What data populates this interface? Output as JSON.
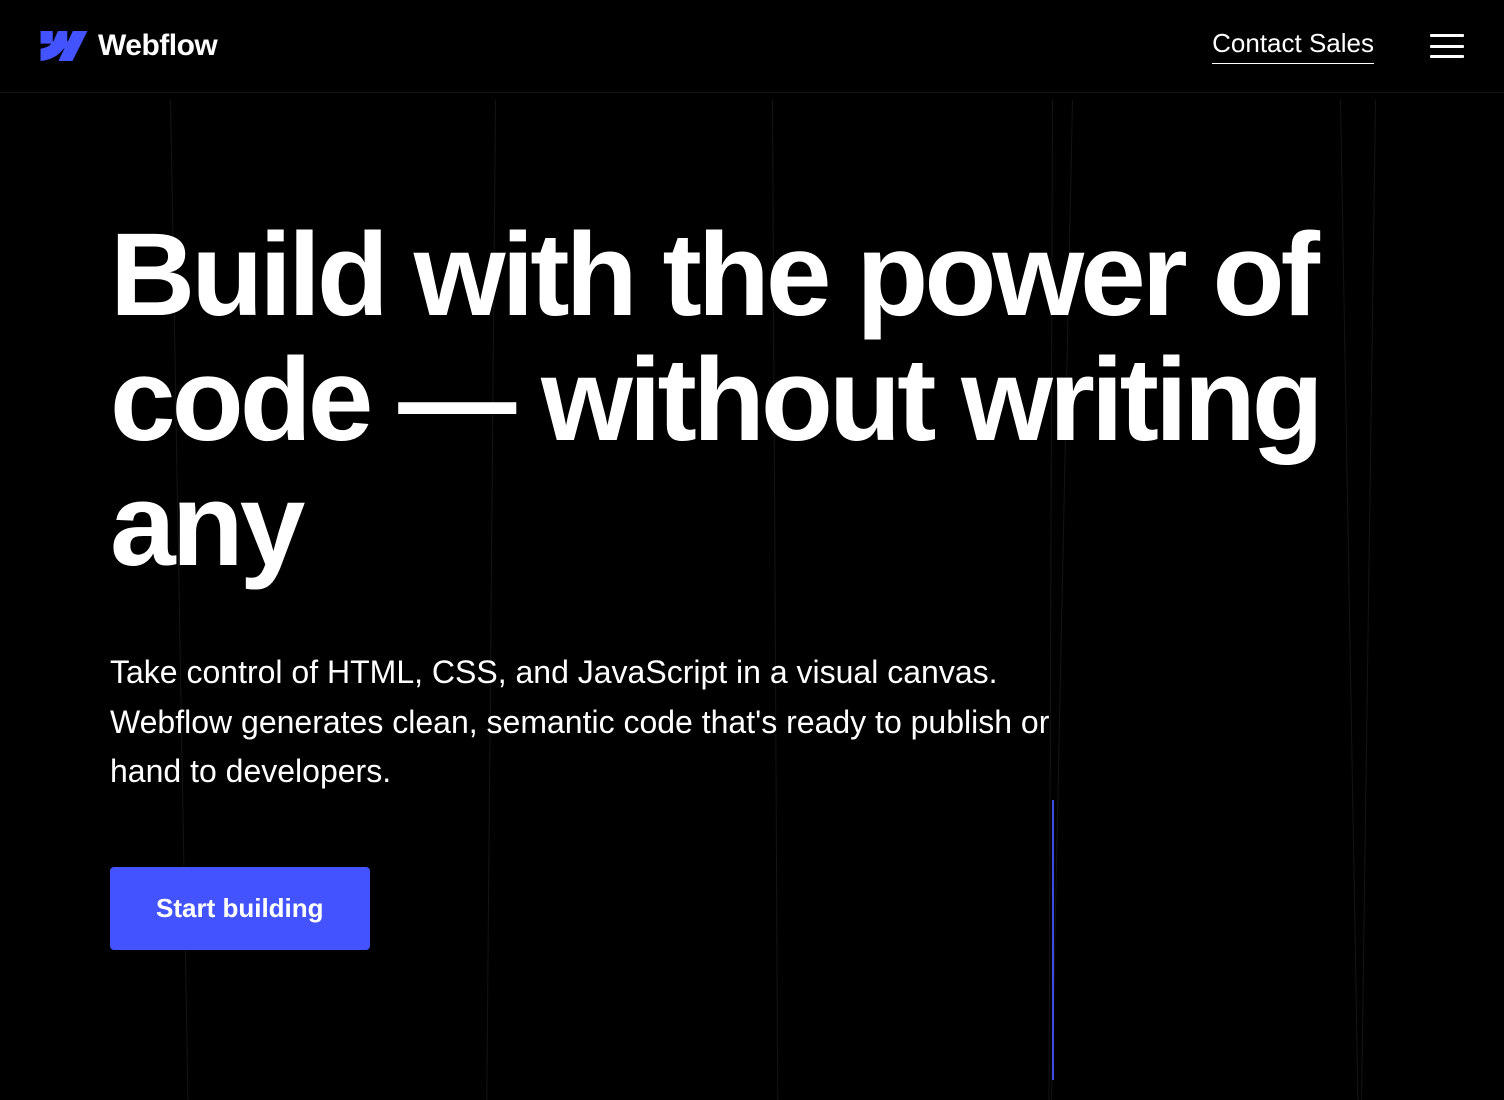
{
  "header": {
    "brand_name": "Webflow",
    "contact_link_label": "Contact Sales"
  },
  "hero": {
    "title": "Build with the power of code — without writing any",
    "subtitle": "Take control of HTML, CSS, and JavaScript in a visual canvas. Webflow generates clean, semantic code that's ready to publish or hand to developers.",
    "cta_label": "Start building"
  },
  "colors": {
    "accent": "#4353ff",
    "background": "#000000",
    "text": "#ffffff"
  }
}
